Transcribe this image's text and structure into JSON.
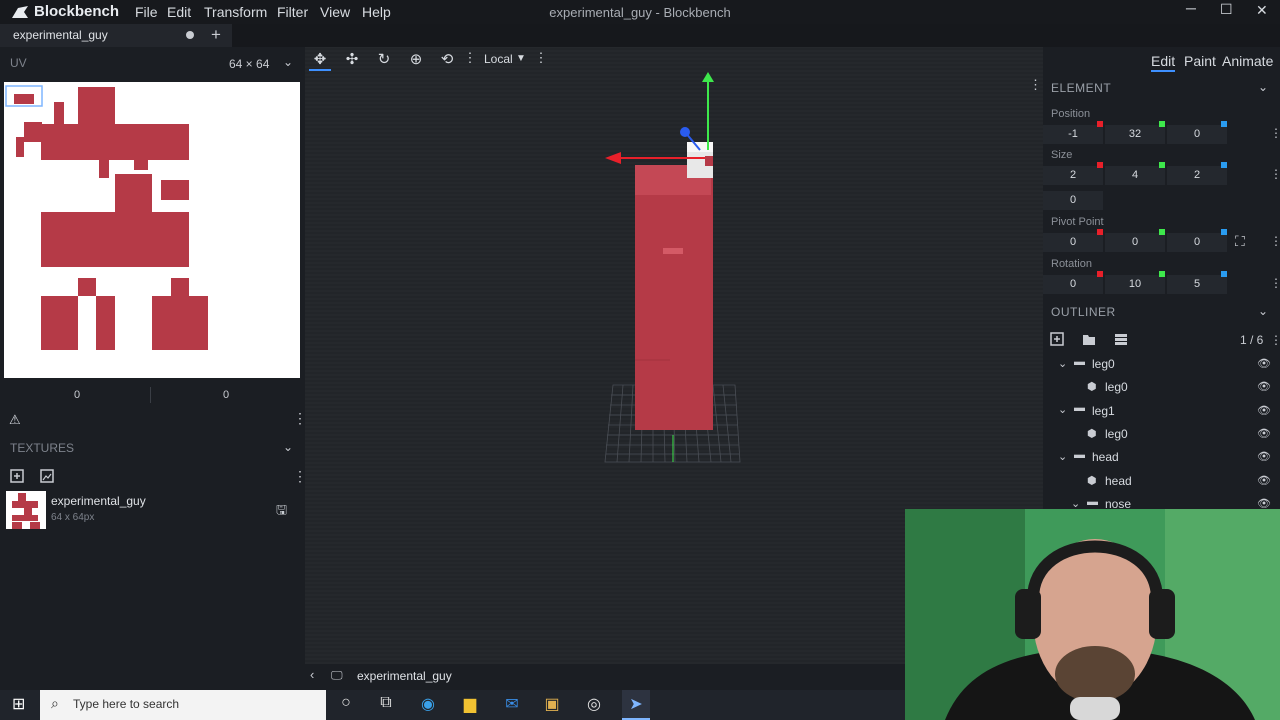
{
  "app": {
    "name": "Blockbench",
    "window_title": "experimental_guy - Blockbench"
  },
  "menu": [
    "File",
    "Edit",
    "Transform",
    "Filter",
    "View",
    "Help"
  ],
  "tab": {
    "label": "experimental_guy",
    "add": "+"
  },
  "uv": {
    "title": "UV",
    "size": "64 × 64",
    "offset_x": "0",
    "offset_y": "0"
  },
  "textures": {
    "title": "TEXTURES",
    "items": [
      {
        "name": "experimental_guy",
        "size": "64 x 64px"
      }
    ]
  },
  "toolbar": {
    "space": "Local"
  },
  "modes": [
    "Edit",
    "Paint",
    "Animate"
  ],
  "element": {
    "title": "ELEMENT",
    "position_label": "Position",
    "position": [
      "-1",
      "32",
      "0"
    ],
    "size_label": "Size",
    "size": [
      "2",
      "4",
      "2"
    ],
    "inflate": "0",
    "pivot_label": "Pivot Point",
    "pivot": [
      "0",
      "0",
      "0"
    ],
    "rotation_label": "Rotation",
    "rotation": [
      "0",
      "10",
      "5"
    ]
  },
  "outliner": {
    "title": "OUTLINER",
    "count": "1 / 6",
    "items": [
      {
        "label": "leg0",
        "type": "group"
      },
      {
        "label": "leg0",
        "type": "cube"
      },
      {
        "label": "leg1",
        "type": "group"
      },
      {
        "label": "leg0",
        "type": "cube"
      },
      {
        "label": "head",
        "type": "group"
      },
      {
        "label": "head",
        "type": "cube"
      },
      {
        "label": "nose",
        "type": "group"
      }
    ]
  },
  "status": {
    "model_name": "experimental_guy"
  },
  "taskbar": {
    "search_placeholder": "Type here to search"
  },
  "colors": {
    "accent": "#3e90ff",
    "texture_red": "#b53a47",
    "axis_x": "#e8202a",
    "axis_y": "#3ee84c",
    "axis_z": "#2a5cf0"
  }
}
